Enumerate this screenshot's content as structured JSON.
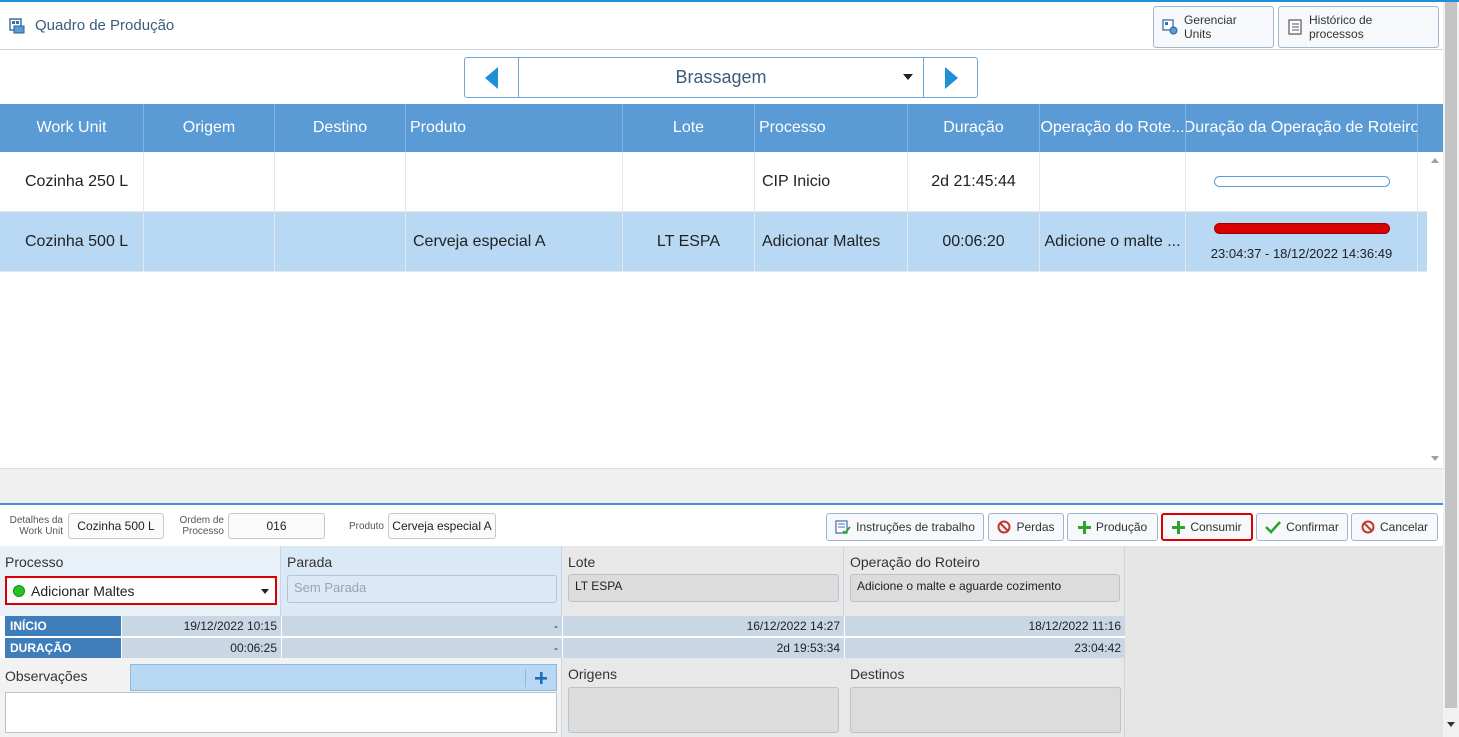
{
  "header": {
    "title": "Quadro de Produção",
    "btn_gerenciar": "Gerenciar Units",
    "btn_historico": "Histórico de processos"
  },
  "nav": {
    "selected": "Brassagem"
  },
  "grid": {
    "columns": [
      "Work Unit",
      "Origem",
      "Destino",
      "Produto",
      "Lote",
      "Processo",
      "Duração",
      "Operação do Rote...",
      "Duração da Operação de Roteiro"
    ],
    "rows": [
      {
        "work_unit": "Cozinha 250 L",
        "origem": "",
        "destino": "",
        "produto": "",
        "lote": "",
        "processo": "CIP Inicio",
        "duracao": "2d 21:45:44",
        "operacao": "",
        "duracao_op": "",
        "progress": 0,
        "selected": false
      },
      {
        "work_unit": "Cozinha 500 L",
        "origem": "",
        "destino": "",
        "produto": "Cerveja especial A",
        "lote": "LT ESPA",
        "processo": "Adicionar Maltes",
        "duracao": "00:06:20",
        "operacao": "Adicione o malte ...",
        "duracao_op": "23:04:37 - 18/12/2022 14:36:49",
        "progress": 1,
        "selected": true
      }
    ]
  },
  "details": {
    "wu_label_1": "Detalhes da",
    "wu_label_2": "Work Unit",
    "wu_value": "Cozinha 500 L",
    "ordem_label_1": "Ordem de",
    "ordem_label_2": "Processo",
    "ordem_value": "016",
    "produto_label": "Produto",
    "produto_value": "Cerveja especial A"
  },
  "actions": {
    "instrucoes": "Instruções de trabalho",
    "perdas": "Perdas",
    "producao": "Produção",
    "consumir": "Consumir",
    "confirmar": "Confirmar",
    "cancelar": "Cancelar"
  },
  "panel": {
    "processo_label": "Processo",
    "processo_value": "Adicionar Maltes",
    "parada_label": "Parada",
    "parada_placeholder": "Sem Parada",
    "lote_label": "Lote",
    "lote_value": "LT ESPA",
    "operacao_label": "Operação do Roteiro",
    "operacao_value": "Adicione o malte e aguarde cozimento",
    "inicio_label": "INÍCIO",
    "duracao_label": "DURAÇÃO",
    "inicio_values": [
      "19/12/2022 10:15",
      "-",
      "16/12/2022 14:27",
      "18/12/2022 11:16"
    ],
    "duracao_values": [
      "00:06:25",
      "-",
      "2d 19:53:34",
      "23:04:42"
    ],
    "observacoes_label": "Observações",
    "origens_label": "Origens",
    "destinos_label": "Destinos"
  },
  "colors": {
    "accent": "#5b9bd5",
    "selected_row": "#b8d8f4",
    "highlight": "#d80000",
    "status_ok": "#24c224"
  }
}
